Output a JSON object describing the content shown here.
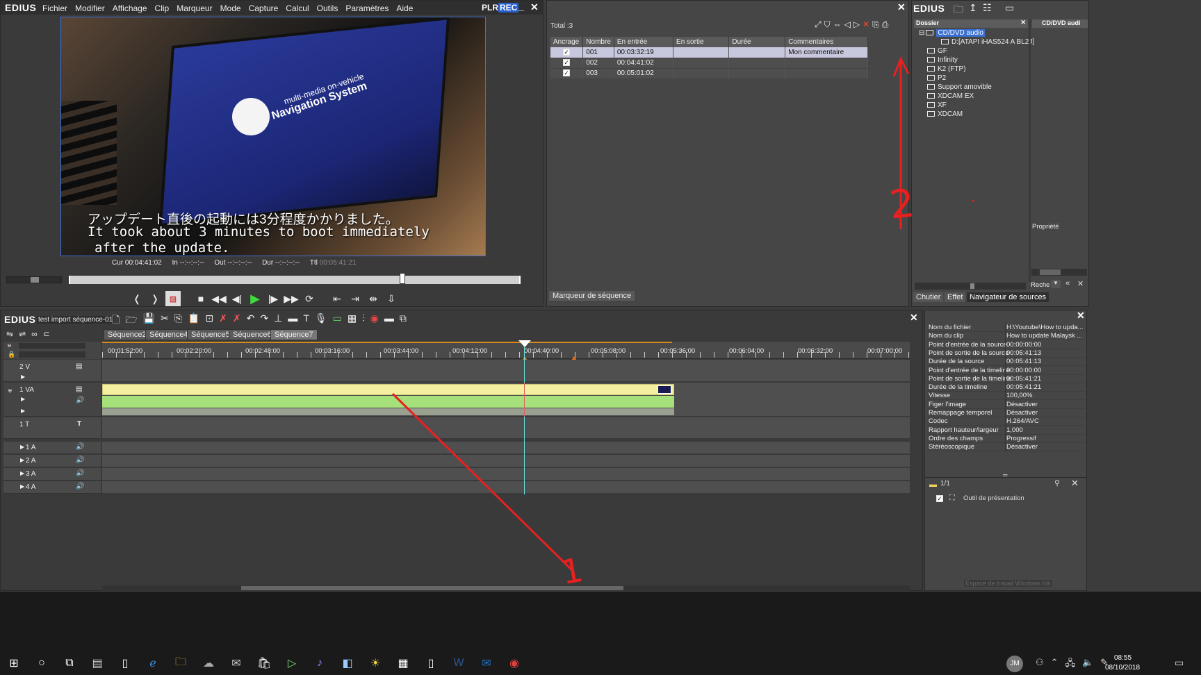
{
  "player": {
    "brand": "EDIUS",
    "menu": [
      "Fichier",
      "Modifier",
      "Affichage",
      "Clip",
      "Marqueur",
      "Mode",
      "Capture",
      "Calcul",
      "Outils",
      "Paramètres",
      "Aide"
    ],
    "plr": "PLR",
    "rec": "REC",
    "subtitle_jp": "アップデート直後の起動には3分程度かかりました。",
    "subtitle_en1": "It took about 3 minutes to boot immediately",
    "subtitle_en2": "after the update.",
    "screen_line1": "multi-media on-vehicle",
    "screen_line2": "Navigation System",
    "cur_label": "Cur",
    "cur_value": "00:04:41:02",
    "in_label": "In",
    "in_value": "--:--:--:--",
    "out_label": "Out",
    "out_value": "--:--:--:--",
    "dur_label": "Dur",
    "dur_value": "--:--:--:--",
    "ttl_label": "Ttl",
    "ttl_value": "00:05:41:21",
    "scrub_position": 0.74
  },
  "markers": {
    "total": "Total :3",
    "columns": [
      "Ancrage",
      "Nombre",
      "En entrée",
      "En sortie",
      "Durée",
      "Commentaires"
    ],
    "rows": [
      {
        "num": "001",
        "in": "00:03:32:19",
        "out": "",
        "dur": "",
        "comment": "Mon commentaire",
        "selected": true
      },
      {
        "num": "002",
        "in": "00:04:41:02",
        "out": "",
        "dur": "",
        "comment": "",
        "selected": false
      },
      {
        "num": "003",
        "in": "00:05:01:02",
        "out": "",
        "dur": "",
        "comment": "",
        "selected": false
      }
    ],
    "tab_label": "Marqueur de séquence",
    "annotation": "2"
  },
  "bin": {
    "brand": "EDIUS",
    "header": "Dossier",
    "right_header": "CD/DVD audi",
    "tree": [
      "CD/DVD audio",
      "D:[ATAPI iHAS524   A BL2J]",
      "GF",
      "Infinity",
      "K2 (FTP)",
      "P2",
      "Support amovible",
      "XDCAM EX",
      "XF",
      "XDCAM"
    ],
    "property_label": "Propriété",
    "search_label": "Reche",
    "tabs": [
      "Chutier",
      "Effet",
      "Navigateur de sources"
    ]
  },
  "timeline": {
    "brand": "EDIUS",
    "project": "test import séquence-01",
    "seq_tabs": [
      "Séquence2",
      "Séquence4",
      "Séquence5",
      "Séquence6",
      "Séquence7"
    ],
    "active_tab": "Séquence7",
    "ruler": [
      "00:01:52:00",
      "00:02:20:00",
      "00:02:48:00",
      "00:03:16:00",
      "00:03:44:00",
      "00:04:12:00",
      "00:04:40:00",
      "00:05:08:00",
      "00:05:36:00",
      "00:06:04:00",
      "00:06:32:00",
      "00:07:00:00"
    ],
    "tracks": [
      "2 V",
      "1 VA",
      "1 T",
      "1 A",
      "2 A",
      "3 A",
      "4 A"
    ],
    "annotation": "1"
  },
  "properties": {
    "rows": [
      {
        "k": "Nom du fichier",
        "v": "H:\\Youtube\\How to upda..."
      },
      {
        "k": "Nom du clip",
        "v": "How to update Malaysk ..."
      },
      {
        "k": "Point d'entrée de la source",
        "v": "00:00:00:00"
      },
      {
        "k": "Point de sortie de la source",
        "v": "00:05:41:13"
      },
      {
        "k": "Durée de la source",
        "v": "00:05:41:13"
      },
      {
        "k": "Point d'entrée de la timeline",
        "v": "00:00:00:00"
      },
      {
        "k": "Point de sortie de la timeline",
        "v": "00:05:41:21"
      },
      {
        "k": "Durée de la timeline",
        "v": "00:05:41:21"
      },
      {
        "k": "Vitesse",
        "v": "100,00%"
      },
      {
        "k": "Figer l'image",
        "v": "Désactiver"
      },
      {
        "k": "Remappage temporel",
        "v": "Désactiver"
      },
      {
        "k": "Codec",
        "v": "H.264/AVC"
      },
      {
        "k": "Rapport hauteur/largeur",
        "v": "1,000"
      },
      {
        "k": "Ordre des champs",
        "v": "Progressif"
      },
      {
        "k": "Stéréoscopique",
        "v": "Désactiver"
      }
    ],
    "page": "1/1",
    "tool": "Outil de présentation",
    "watermark": "Espace de travail Windows Ink"
  },
  "taskbar": {
    "time": "08:55",
    "date": "08/10/2018",
    "user": "JM",
    "apps": [
      "start-icon",
      "search-icon",
      "task-view-icon",
      "app1-icon",
      "file-icon",
      "edge-icon",
      "explorer-icon",
      "app2-icon",
      "app3-icon",
      "store-icon",
      "edius-icon",
      "audio-app-icon",
      "app4-icon",
      "app5-icon",
      "calculator-icon",
      "file2-icon",
      "word-icon",
      "outlook-icon",
      "chrome-icon"
    ]
  },
  "colors": {
    "annotation": "#e82020",
    "clip_yellow": "#f3ef9e",
    "clip_green": "#a6e07a",
    "selection": "#c7c7dd",
    "play_green": "#3cdc3c"
  }
}
